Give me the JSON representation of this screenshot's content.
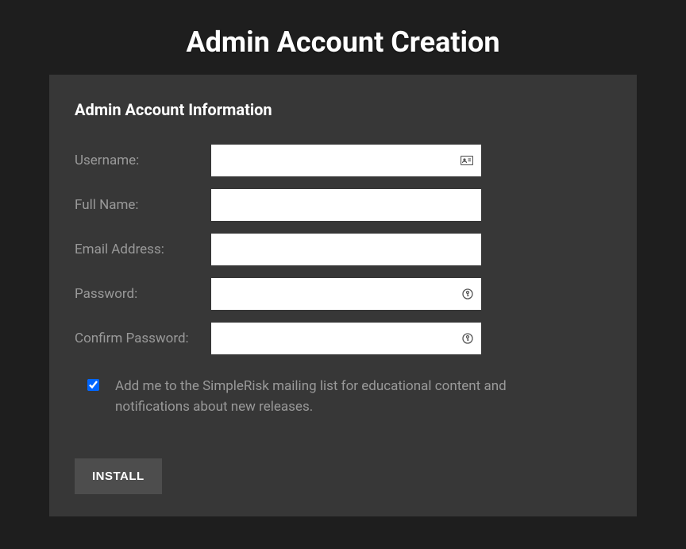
{
  "page": {
    "title": "Admin Account Creation"
  },
  "section": {
    "title": "Admin Account Information"
  },
  "form": {
    "username": {
      "label": "Username:",
      "value": ""
    },
    "fullname": {
      "label": "Full Name:",
      "value": ""
    },
    "email": {
      "label": "Email Address:",
      "value": ""
    },
    "password": {
      "label": "Password:",
      "value": ""
    },
    "confirm_password": {
      "label": "Confirm Password:",
      "value": ""
    },
    "mailing_list": {
      "label": "Add me to the SimpleRisk mailing list for educational content and notifications about new releases.",
      "checked": true
    }
  },
  "actions": {
    "install_label": "INSTALL"
  }
}
